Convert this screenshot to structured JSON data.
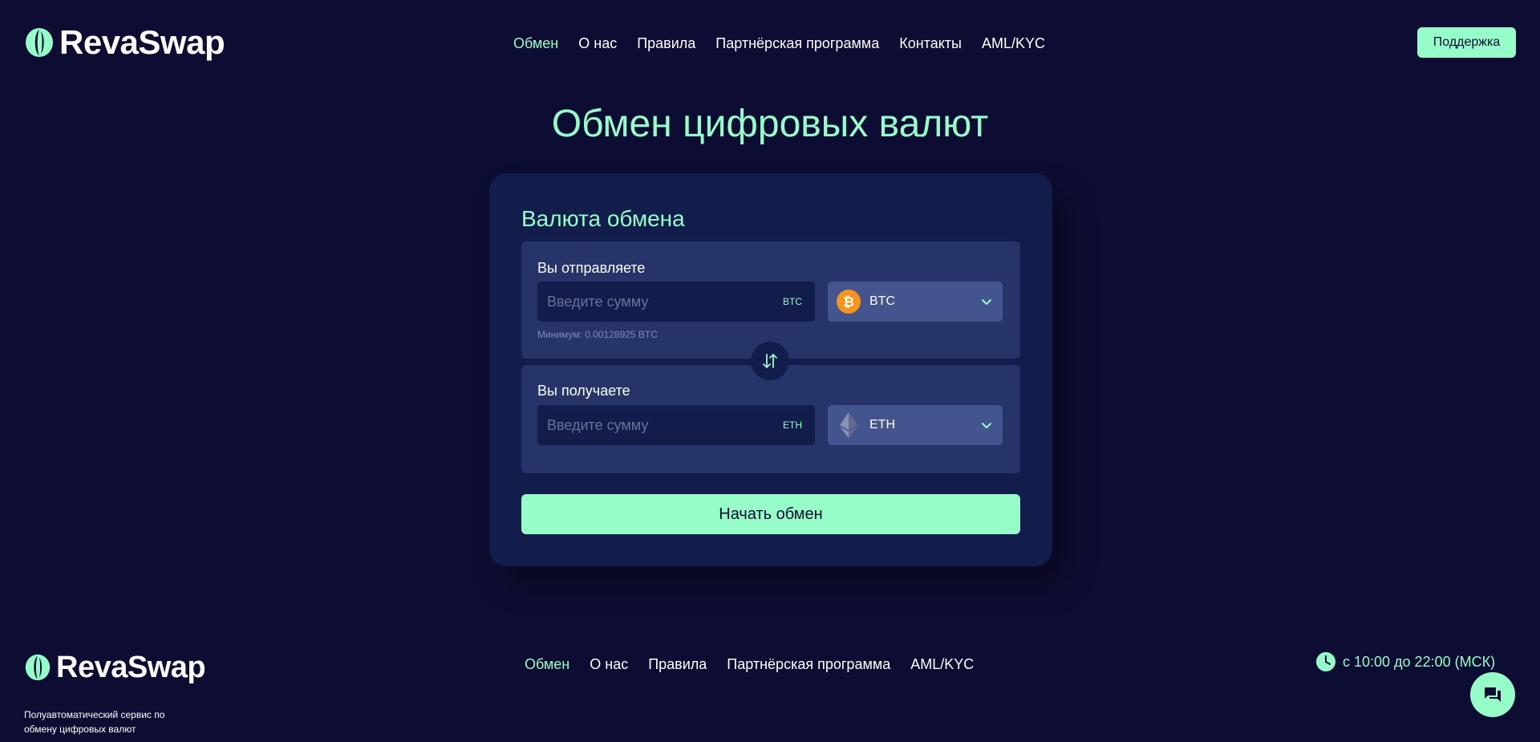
{
  "brand": {
    "name": "RevaSwap",
    "accent": "#96fcc8",
    "background": "#0d0d33"
  },
  "header": {
    "nav": [
      {
        "label": "Обмен",
        "active": true
      },
      {
        "label": "О нас",
        "active": false
      },
      {
        "label": "Правила",
        "active": false
      },
      {
        "label": "Партнёрская программа",
        "active": false
      },
      {
        "label": "Контакты",
        "active": false
      },
      {
        "label": "AML/KYC",
        "active": false
      }
    ],
    "support_label": "Поддержка"
  },
  "main": {
    "title": "Обмен цифровых валют",
    "card": {
      "title": "Валюта обмена",
      "send": {
        "label": "Вы отправляете",
        "placeholder": "Введите сумму",
        "unit": "BTC",
        "min_note": "Минимум: 0.00128925 BTC",
        "coin": {
          "name": "BTC",
          "icon": "bitcoin-icon",
          "color": "#f7931a"
        }
      },
      "receive": {
        "label": "Вы получаете",
        "placeholder": "Введите сумму",
        "unit": "ETH",
        "coin": {
          "name": "ETH",
          "icon": "ethereum-icon",
          "color": "#8a92b2"
        }
      },
      "swap_icon": "swap-arrows-icon",
      "start_label": "Начать обмен"
    }
  },
  "footer": {
    "description": "Полуавтоматический сервис по обмену цифровых валют",
    "nav": [
      {
        "label": "Обмен",
        "active": true
      },
      {
        "label": "О нас",
        "active": false
      },
      {
        "label": "Правила",
        "active": false
      },
      {
        "label": "Партнёрская программа",
        "active": false
      },
      {
        "label": "AML/KYC",
        "active": false
      }
    ],
    "hours": "с 10:00 до 22:00 (МСК)",
    "chat_icon": "chat-icon"
  }
}
